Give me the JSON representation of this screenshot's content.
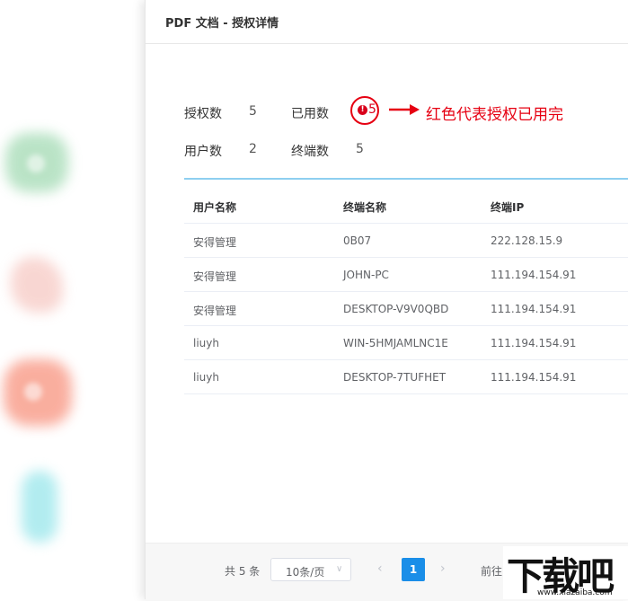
{
  "dialog": {
    "title": "PDF 文档 - 授权详情"
  },
  "stats": {
    "license_label": "授权数",
    "license_value": "5",
    "used_label": "已用数",
    "used_value": "5",
    "user_label": "用户数",
    "user_value": "2",
    "terminal_label": "终端数",
    "terminal_value": "5"
  },
  "annotation": {
    "text": "红色代表授权已用完",
    "color": "#e60012"
  },
  "table": {
    "headers": [
      "用户名称",
      "终端名称",
      "终端IP"
    ],
    "rows": [
      [
        "安得管理",
        "0B07",
        "222.128.15.9"
      ],
      [
        "安得管理",
        "JOHN-PC",
        "111.194.154.91"
      ],
      [
        "安得管理",
        "DESKTOP-V9V0QBD",
        "111.194.154.91"
      ],
      [
        "liuyh",
        "WIN-5HMJAMLNC1E",
        "111.194.154.91"
      ],
      [
        "liuyh",
        "DESKTOP-7TUFHET",
        "111.194.154.91"
      ]
    ]
  },
  "pagination": {
    "total": "共 5 条",
    "page_size": "10条/页",
    "current_page": "1",
    "goto_label": "前往"
  },
  "watermark": {
    "logo_text": "下载吧",
    "url": "www.xiazaiba.com"
  },
  "colors": {
    "accent": "#1a8ee8",
    "alert": "#d9001b",
    "divider": "#8ecff0"
  }
}
